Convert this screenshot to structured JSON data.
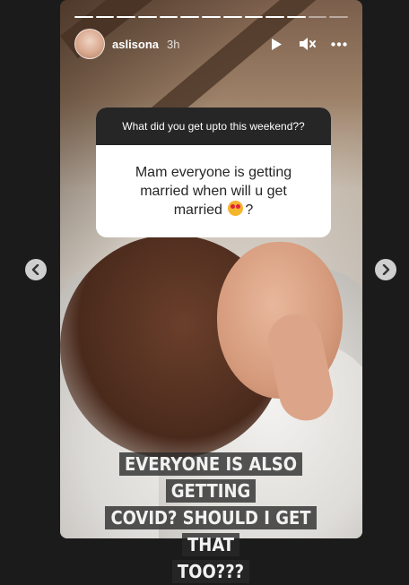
{
  "story": {
    "progress_total": 13,
    "progress_done": 11
  },
  "header": {
    "username": "aslisona",
    "time": "3h",
    "icons": [
      "play-icon",
      "mute-icon",
      "more-icon"
    ]
  },
  "question_sticker": {
    "question": "What did you get upto this weekend??",
    "answer": "Mam everyone is getting married when will u get married",
    "answer_suffix": "?",
    "emoji": "heart-eyes-emoji"
  },
  "caption": {
    "line1": "EVERYONE IS ALSO GETTING",
    "line2": "COVID? SHOULD I GET THAT",
    "line3": "TOO???"
  },
  "navigation": {
    "left_icon": "chevron-left-icon",
    "right_icon": "chevron-right-icon"
  },
  "colors": {
    "page_background": "#1b1b1b",
    "sticker_header": "#262626",
    "nav_button": "#cfcfcf"
  }
}
